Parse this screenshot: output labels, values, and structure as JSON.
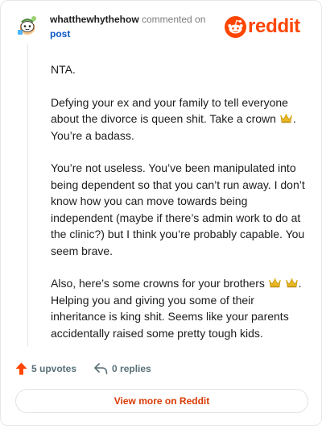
{
  "comment": {
    "username": "whatthewhythehow",
    "action_text": " commented on",
    "post_link": "post",
    "brand": "reddit",
    "paragraphs": {
      "p1": "NTA.",
      "p2_text": "Defying your ex and your family to tell everyone about the divorce is queen shit. Take a crown ",
      "p2_tail": ". You’re a badass.",
      "p3": "You’re not useless. You’ve been manipulated into being dependent so that you can’t run away. I don’t know how you can move towards being independent (maybe if there’s admin work to do at the clinic?) but I think you’re probably capable. You seem brave.",
      "p4_text": "Also, here’s some crowns for your brothers ",
      "p4_tail": ". Helping you and giving you some of their inheritance is king shit. Seems like your parents accidentally raised some pretty tough kids."
    },
    "upvotes": "5 upvotes",
    "replies": "0 replies",
    "view_more": "View more on Reddit"
  },
  "icons": {
    "avatar": "snoo-avatar-icon",
    "brand": "reddit-logo-icon",
    "crown": "crown-emoji-icon",
    "upvote": "upvote-arrow-icon",
    "reply": "reply-arrow-icon"
  },
  "colors": {
    "brand": "#ff4500",
    "link": "#0a56c7",
    "view_more": "#d93900",
    "muted": "#576f76"
  }
}
